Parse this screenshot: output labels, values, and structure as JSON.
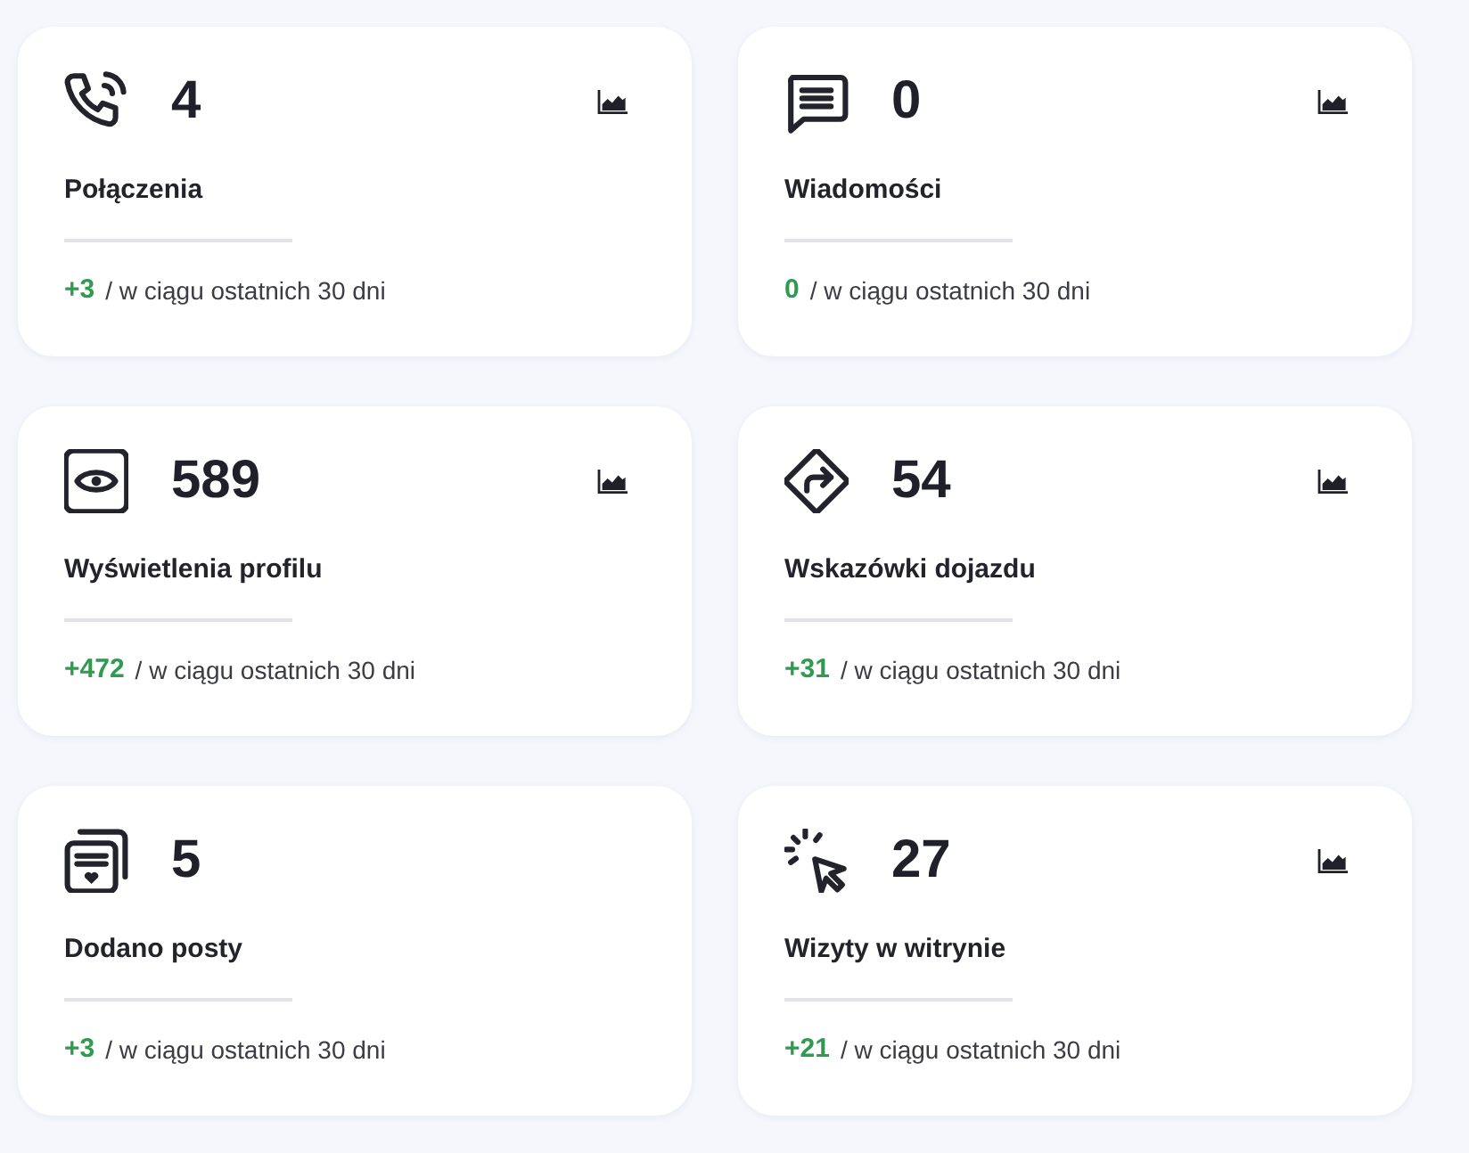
{
  "cards": [
    {
      "kind": "phone",
      "value": "4",
      "title": "Połączenia",
      "change": "+3",
      "period": "/ w ciągu ostatnich 30 dni",
      "chart_button": true
    },
    {
      "kind": "message",
      "value": "0",
      "title": "Wiadomości",
      "change": "0",
      "period": "/ w ciągu ostatnich 30 dni",
      "chart_button": true
    },
    {
      "kind": "eye",
      "value": "589",
      "title": "Wyświetlenia profilu",
      "change": "+472",
      "period": "/ w ciągu ostatnich 30 dni",
      "chart_button": true
    },
    {
      "kind": "directions",
      "value": "54",
      "title": "Wskazówki dojazdu",
      "change": "+31",
      "period": "/ w ciągu ostatnich 30 dni",
      "chart_button": true
    },
    {
      "kind": "posts",
      "value": "5",
      "title": "Dodano posty",
      "change": "+3",
      "period": "/ w ciągu ostatnich 30 dni",
      "chart_button": false
    },
    {
      "kind": "click",
      "value": "27",
      "title": "Wizyty w witrynie",
      "change": "+21",
      "period": "/ w ciągu ostatnich 30 dni",
      "chart_button": true
    }
  ]
}
